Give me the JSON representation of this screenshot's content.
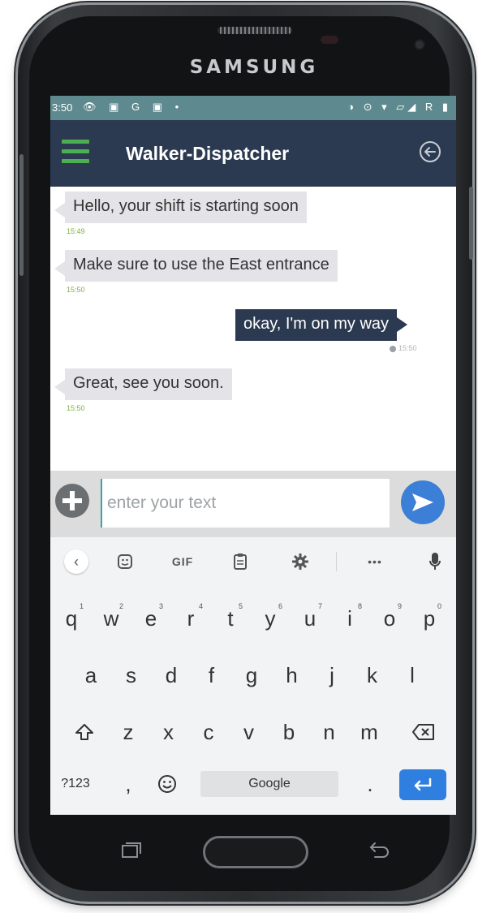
{
  "device": {
    "brand": "SAMSUNG"
  },
  "status_bar": {
    "time": "3:50",
    "left_icons": "👁 ▣ G ▣ •",
    "right_icons": "◑ ⊙ ▾ ▱◢ R ▮"
  },
  "app_bar": {
    "title": "Walker-Dispatcher"
  },
  "messages": [
    {
      "text": "Hello, your shift is starting soon",
      "time": "15:49",
      "direction": "incoming"
    },
    {
      "text": "Make sure to use the East entrance",
      "time": "15:50",
      "direction": "incoming"
    },
    {
      "text": "okay, I'm on my way",
      "time": "15:50",
      "direction": "outgoing"
    },
    {
      "text": "Great, see you soon.",
      "time": "15:50",
      "direction": "incoming"
    }
  ],
  "composer": {
    "placeholder": "enter your text",
    "value": ""
  },
  "keyboard_toolbar": {
    "gif": "GIF",
    "more": "•••"
  },
  "keyboard": {
    "row1": [
      {
        "k": "q",
        "n": "1"
      },
      {
        "k": "w",
        "n": "2"
      },
      {
        "k": "e",
        "n": "3"
      },
      {
        "k": "r",
        "n": "4"
      },
      {
        "k": "t",
        "n": "5"
      },
      {
        "k": "y",
        "n": "6"
      },
      {
        "k": "u",
        "n": "7"
      },
      {
        "k": "i",
        "n": "8"
      },
      {
        "k": "o",
        "n": "9"
      },
      {
        "k": "p",
        "n": "0"
      }
    ],
    "row2": [
      "a",
      "s",
      "d",
      "f",
      "g",
      "h",
      "j",
      "k",
      "l"
    ],
    "row3": [
      "z",
      "x",
      "c",
      "v",
      "b",
      "n",
      "m"
    ],
    "symbols": "?123",
    "comma": ",",
    "space": "Google",
    "period": "."
  },
  "colors": {
    "app_bar": "#2b3a51",
    "status_bar": "#5e8a8f",
    "accent_green": "#4caf50",
    "send": "#3b7fd6",
    "bubble_in": "#e4e4e8"
  }
}
